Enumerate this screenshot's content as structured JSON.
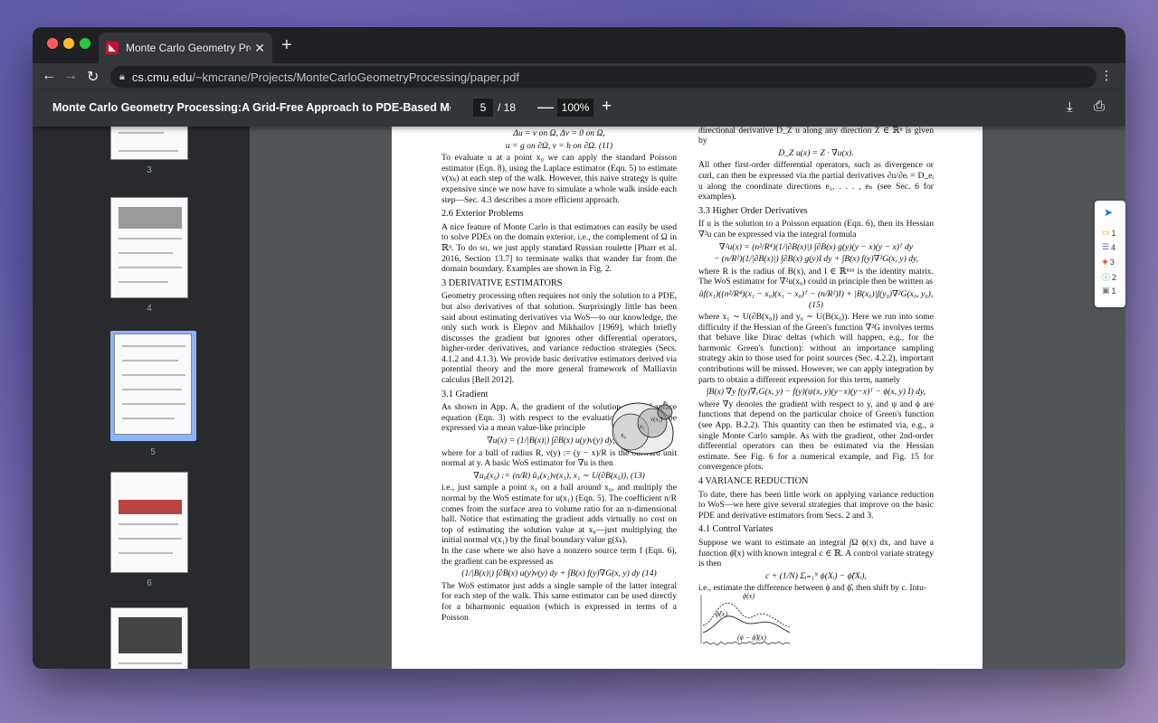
{
  "tab": {
    "title": "Monte Carlo Geometry Processi",
    "close": "✕",
    "new": "+"
  },
  "omnibox": {
    "host": "cs.cmu.edu",
    "path": "/~kmcrane/Projects/MonteCarloGeometryProcessing/paper.pdf"
  },
  "pdf": {
    "title": "Monte Carlo Geometry Processing:A Grid-Free Approach to PDE-Based Methods o...",
    "page": "5",
    "total": "/ 18",
    "zoom": "100%"
  },
  "thumbnails": [
    {
      "num": "3"
    },
    {
      "num": "4"
    },
    {
      "num": "5"
    },
    {
      "num": "6"
    }
  ],
  "left": [
    {
      "kind": "eq",
      "text": "Δu = v   on Ω,     Δv = 0   on Ω,"
    },
    {
      "kind": "eq",
      "text": "u = g   on ∂Ω,      v = h   on ∂Ω.        (11)"
    },
    {
      "kind": "para",
      "text": "To evaluate u at a point x₀ we can apply the standard Poisson estimator (Eqn. 8), using the Laplace estimator (Eqn. 5) to estimate v(xₖ) at each step of the walk. However, this naive strategy is quite expensive since we now have to simulate a whole walk inside each step—Sec. 4.3 describes a more efficient approach."
    },
    {
      "kind": "head",
      "text": "2.6   Exterior Problems"
    },
    {
      "kind": "para",
      "text": "A nice feature of Monte Carlo is that estimators can easily be used to solve PDEs on the domain exterior, i.e., the complement of Ω in ℝⁿ. To do so, we just apply standard Russian roulette [Pharr et al. 2016, Section 13.7] to terminate walks that wander far from the domain boundary. Examples are shown in Fig. 2."
    },
    {
      "kind": "head",
      "text": "3   DERIVATIVE ESTIMATORS"
    },
    {
      "kind": "para",
      "text": "Geometry processing often requires not only the solution to a PDE, but also derivatives of that solution. Surprisingly little has been said about estimating derivatives via WoS—to our knowledge, the only such work is Elepov and Mikhailov [1969], which briefly discusses the gradient but ignores other differential operators, higher-order derivatives, and variance reduction strategies (Secs. 4.1.2 and 4.1.3). We provide basic derivative estimators derived via potential theory and the more general framework of Malliavin calculus [Bell 2012]."
    },
    {
      "kind": "head",
      "text": "3.1   Gradient"
    },
    {
      "kind": "para",
      "text": "As shown in App. A, the gradient of the solution u to a Laplace equation (Eqn. 3) with respect to the evaluation point x can be expressed via a mean value-like principle"
    },
    {
      "kind": "eq",
      "text": "∇u(x) = (1/|B(x)|) ∫∂B(x) u(y)ν(y) dy,      (12)"
    },
    {
      "kind": "para",
      "text": "where for a ball of radius R, ν(y) := (y − x)/R is the outward unit normal at y. A basic WoS estimator for ∇u is then"
    },
    {
      "kind": "eq",
      "text": "∇u₀(x₀) := (n/R) û₀(x₁)ν(x₁),    x₁ ∼ U(∂B(x₀)),       (13)"
    },
    {
      "kind": "para",
      "text": "i.e., just sample a point x₁ on a ball around x₀, and multiply the normal by the WoS estimate for u(x₁) (Eqn. 5). The coefficient n/R comes from the surface area to volume ratio for an n-dimensional ball. Notice that estimating the gradient adds virtually no cost on top of estimating the solution value at x₀—just multiplying the initial normal ν(x₁) by the final boundary value g(x̄ₖ)."
    },
    {
      "kind": "para",
      "text": "    In the case where we also have a nonzero source term f (Eqn. 6), the gradient can be expressed as"
    },
    {
      "kind": "eq",
      "text": "(1/|B(x)|) ∫∂B(x) u(y)ν(y) dy + ∫B(x) f(y)∇G(x, y) dy       (14)"
    },
    {
      "kind": "para",
      "text": "The WoS estimator just adds a single sample of the latter integral for each step of the walk. This same estimator can be used directly for a biharmonic equation (which is expressed in terms of a Poisson"
    }
  ],
  "right": [
    {
      "kind": "para",
      "text": "Given an estimator for the gradient ∇u, an estimator for the directional derivative D_Z u along any direction Z ∈ ℝⁿ is given by"
    },
    {
      "kind": "eq",
      "text": "D_Z u(x) = Z · ∇u(x)."
    },
    {
      "kind": "para",
      "text": "All other first-order differential operators, such as divergence or curl, can then be expressed via the partial derivatives ∂u/∂eᵢ = D_eᵢ u along the coordinate directions e₁, . . . , eₙ (see Sec. 6 for examples)."
    },
    {
      "kind": "head",
      "text": "3.3   Higher Order Derivatives"
    },
    {
      "kind": "para",
      "text": "If u is the solution to a Poisson equation (Eqn. 6), then its Hessian ∇²u can be expressed via the integral formula"
    },
    {
      "kind": "eq",
      "text": "∇²u(x) = (n²/R⁴)(1/|∂B(x)|) ∫∂B(x) g(y)(y − x)(y − x)ᵀ dy"
    },
    {
      "kind": "eq",
      "text": "− (n/R²)(1/|∂B(x)|) ∫∂B(x) g(y)I dy + ∫B(x) f(y)∇²G(x, y) dy,"
    },
    {
      "kind": "para",
      "text": "where R is the radius of B(x), and I ∈ ℝⁿˣⁿ is the identity matrix. The WoS estimator for ∇²u(x₀) could in principle then be written as"
    },
    {
      "kind": "eq",
      "text": "ûf(x₁)((n²/R⁴)(x₁ − x₀)(x₁ − x₀)ᵀ − (n/R²)I) + |B(x₀)|f(y₀)∇²G(x₀, y₀),   (15)"
    },
    {
      "kind": "para",
      "text": "where x₁ ∼ U(∂B(x₀)) and y₀ ∼ U(B(x₀)). Here we run into some difficulty if the Hessian of the Green's function ∇²G involves terms that behave like Dirac deltas (which will happen, e.g., for the harmonic Green's function): without an importance sampling strategy akin to those used for point sources (Sec. 4.2.2), important contributions will be missed. However, we can apply integration by parts to obtain a different expression for this term, namely"
    },
    {
      "kind": "eq",
      "text": "∫B(x) ∇y f(y)∇ₓG(x, y) − f(y)(ψ(x, y)(y−x)(y−x)ᵀ − ϕ(x, y) I) dy,"
    },
    {
      "kind": "para",
      "text": "where ∇y denotes the gradient with respect to y, and ψ and ϕ are functions that depend on the particular choice of Green's function (see App. B.2.2). This quantity can then be estimated via, e.g., a single Monte Carlo sample. As with the gradient, other 2nd-order differential operators can then be estimated via the Hessian estimate. See Fig. 6 for a numerical example, and Fig. 15 for convergence plots."
    },
    {
      "kind": "head",
      "text": "4   VARIANCE REDUCTION"
    },
    {
      "kind": "para",
      "text": "To date, there has been little work on applying variance reduction to WoS—we here give several strategies that improve on the basic PDE and derivative estimators from Secs. 2 and 3."
    },
    {
      "kind": "head",
      "text": "4.1   Control Variates"
    },
    {
      "kind": "para",
      "text": "Suppose we want to estimate an integral ∫Ω ϕ(x) dx, and have a function ϕ̂(x) with known integral c ∈ ℝ. A control variate strategy is then"
    },
    {
      "kind": "eq",
      "text": "c + (1/N) Σᵢ₌₁ᴺ ϕ(Xᵢ) − ϕ̂(Xᵢ),"
    },
    {
      "kind": "para",
      "text": "i.e., estimate the difference between ϕ and ϕ̂, then shift by c. Intu-"
    }
  ],
  "figure1": {
    "labels": [
      "x₀",
      "x̄ₖ",
      "x₁",
      "ν(x₁)"
    ]
  },
  "figure2": {
    "labels": [
      "ϕ(x)",
      "ϕ̂(x)",
      "(ϕ − ϕ̂)(x)"
    ]
  },
  "widget": {
    "items": [
      {
        "count": "1",
        "icon": "folder-icon"
      },
      {
        "count": "4",
        "icon": "notes-icon"
      },
      {
        "count": "3",
        "icon": "cube-icon"
      },
      {
        "count": "2",
        "icon": "alert-icon"
      },
      {
        "count": "1",
        "icon": "badge-icon"
      }
    ]
  }
}
